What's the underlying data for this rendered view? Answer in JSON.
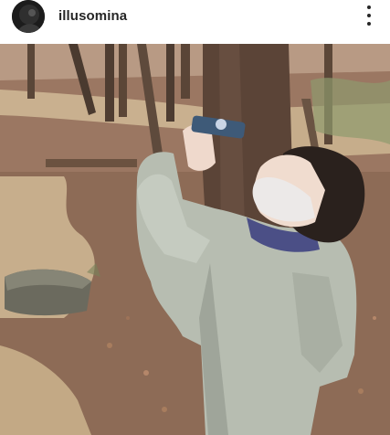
{
  "post": {
    "username": "illusomina",
    "more_icon": "more-vertical-icon",
    "photo_subject": "photo"
  }
}
